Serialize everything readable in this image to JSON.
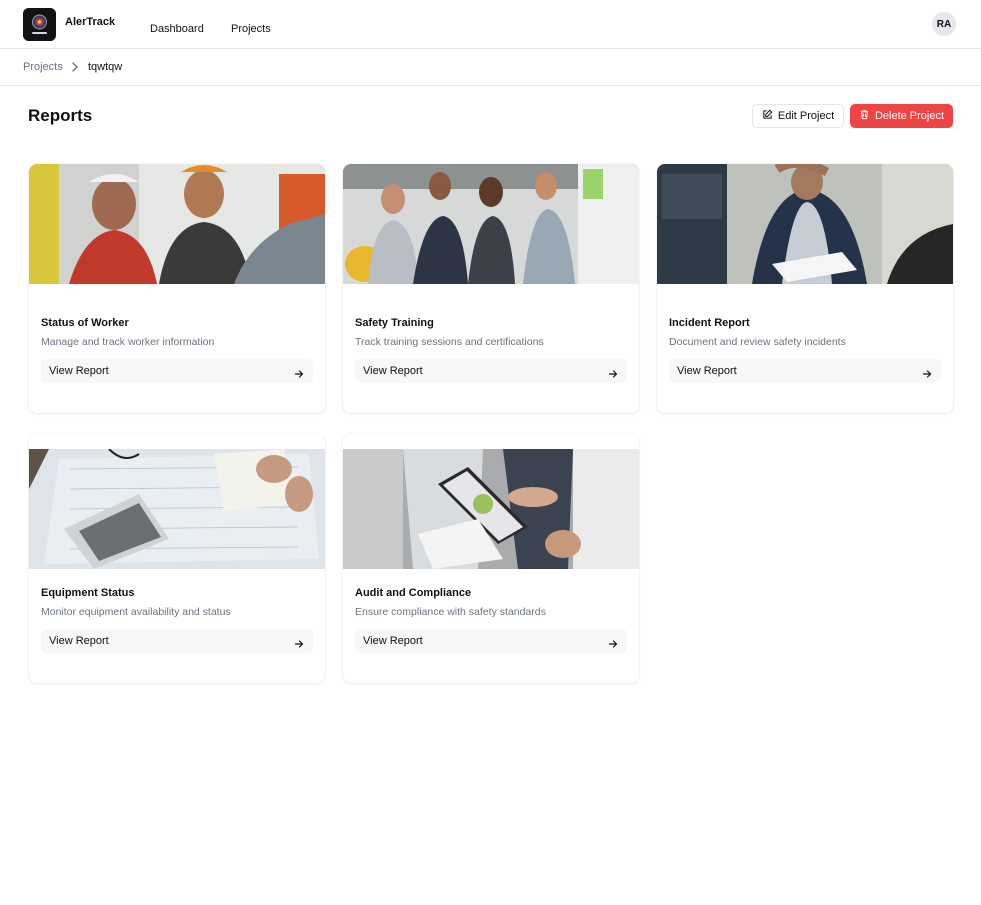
{
  "app": {
    "name": "AlerTrack",
    "user_initials": "RA"
  },
  "nav": {
    "items": [
      {
        "label": "Dashboard"
      },
      {
        "label": "Projects"
      }
    ]
  },
  "breadcrumb": {
    "parent": "Projects",
    "current": "tqwtqw"
  },
  "page": {
    "title": "Reports",
    "edit_label": "Edit Project",
    "delete_label": "Delete Project"
  },
  "colors": {
    "danger": "#ef4444",
    "border": "#e5e7eb",
    "muted_text": "#6b7280",
    "button_bg": "#f7f7f8"
  },
  "reports": [
    {
      "title": "Status of Worker",
      "description": "Manage and track worker information",
      "action": "View Report",
      "icon": "arrow-right-icon"
    },
    {
      "title": "Safety Training",
      "description": "Track training sessions and certifications",
      "action": "View Report",
      "icon": "arrow-right-icon"
    },
    {
      "title": "Incident Report",
      "description": "Document and review safety incidents",
      "action": "View Report",
      "icon": "arrow-right-icon"
    },
    {
      "title": "Equipment Status",
      "description": "Monitor equipment availability and status",
      "action": "View Report",
      "icon": "arrow-right-icon"
    },
    {
      "title": "Audit and Compliance",
      "description": "Ensure compliance with safety standards",
      "action": "View Report",
      "icon": "arrow-right-icon"
    }
  ]
}
